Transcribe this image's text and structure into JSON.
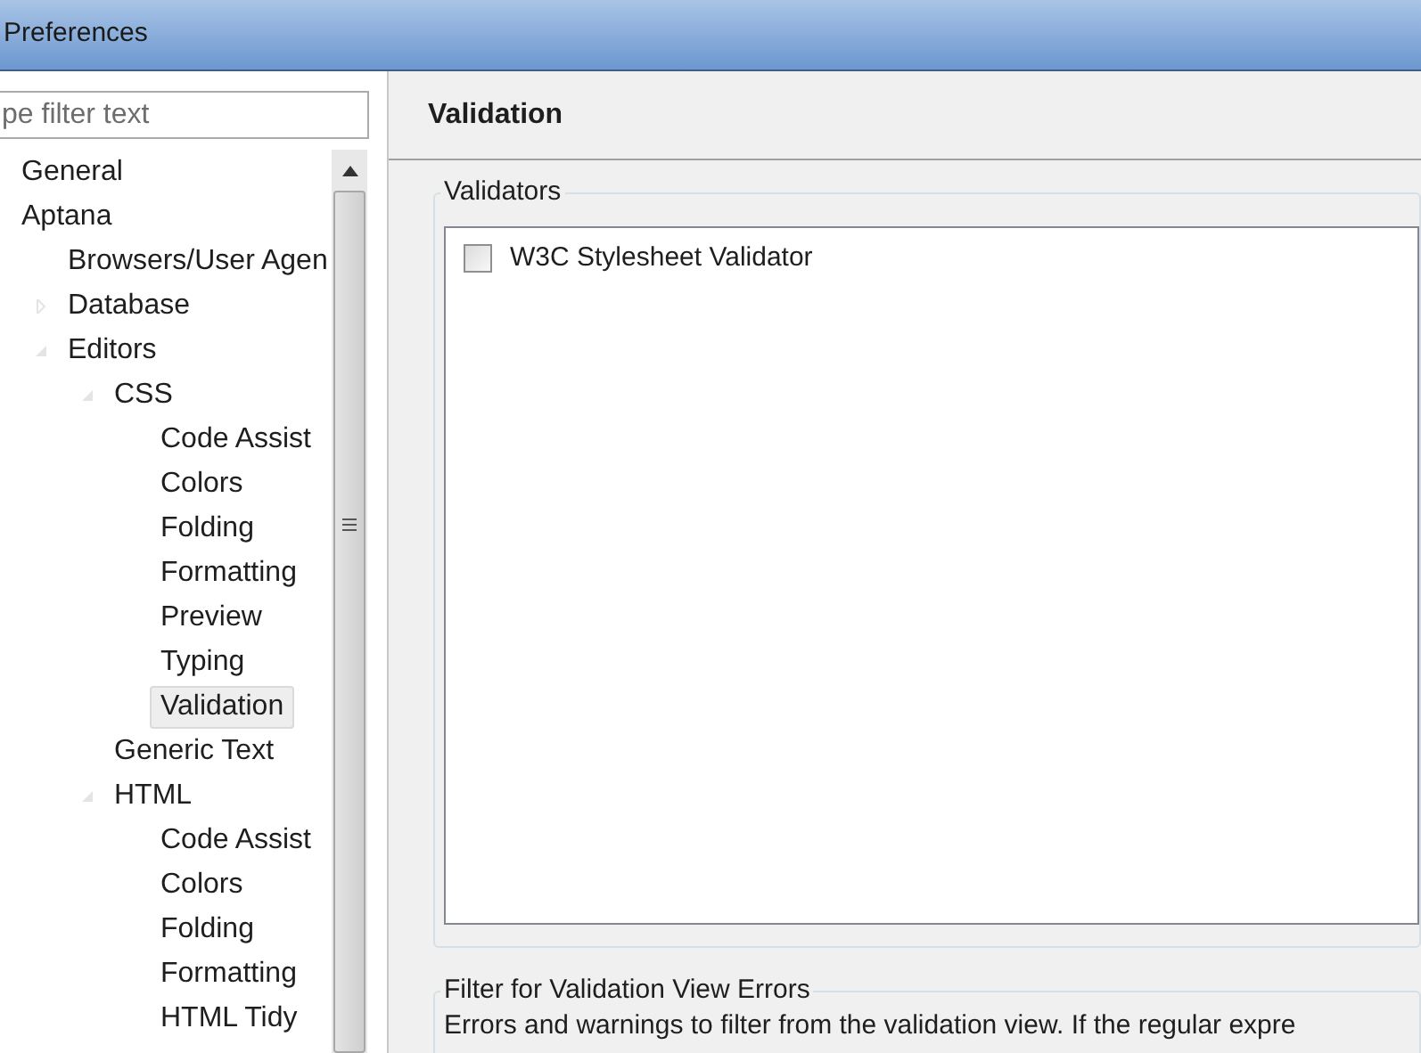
{
  "window": {
    "title": "Preferences"
  },
  "filter": {
    "placeholder": "pe filter text"
  },
  "tree": [
    {
      "label": "General",
      "selected": false
    },
    {
      "label": "Aptana",
      "selected": false,
      "children": [
        {
          "label": "Browsers/User Agen",
          "selected": false
        },
        {
          "label": "Database",
          "selected": false,
          "expanded": false
        },
        {
          "label": "Editors",
          "selected": false,
          "expanded": true,
          "children": [
            {
              "label": "CSS",
              "selected": false,
              "expanded": true,
              "children": [
                {
                  "label": "Code Assist",
                  "selected": false
                },
                {
                  "label": "Colors",
                  "selected": false
                },
                {
                  "label": "Folding",
                  "selected": false
                },
                {
                  "label": "Formatting",
                  "selected": false
                },
                {
                  "label": "Preview",
                  "selected": false
                },
                {
                  "label": "Typing",
                  "selected": false
                },
                {
                  "label": "Validation",
                  "selected": true
                }
              ]
            },
            {
              "label": "Generic Text",
              "selected": false
            },
            {
              "label": "HTML",
              "selected": false,
              "expanded": true,
              "children": [
                {
                  "label": "Code Assist",
                  "selected": false
                },
                {
                  "label": "Colors",
                  "selected": false
                },
                {
                  "label": "Folding",
                  "selected": false
                },
                {
                  "label": "Formatting",
                  "selected": false
                },
                {
                  "label": "HTML Tidy",
                  "selected": false
                }
              ]
            }
          ]
        }
      ]
    }
  ],
  "page": {
    "title": "Validation",
    "validators": {
      "title": "Validators",
      "items": [
        {
          "label": "W3C Stylesheet Validator",
          "checked": false
        }
      ]
    },
    "filter_group": {
      "title": "Filter for Validation View Errors",
      "text": "Errors and warnings to filter from the validation view. If the regular expre"
    }
  }
}
